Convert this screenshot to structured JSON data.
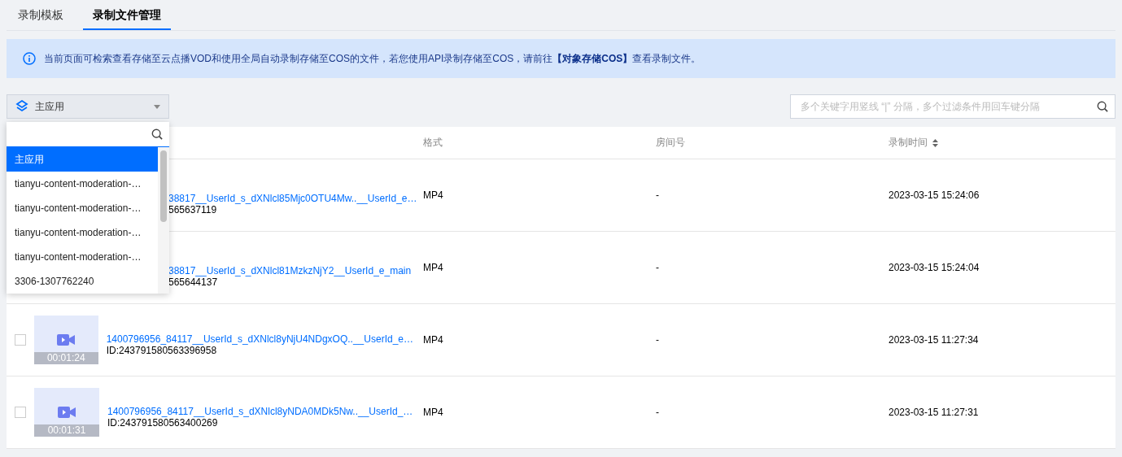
{
  "tabs": [
    {
      "label": "录制模板",
      "selected": false
    },
    {
      "label": "录制文件管理",
      "selected": true
    }
  ],
  "notice": {
    "text": "当前页面可检索查看存储至云点播VOD和使用全局自动录制存储至COS的文件，若您使用API录制存储至COS，请前往",
    "link": "【对象存储COS】",
    "tail": "查看录制文件。"
  },
  "app_select": {
    "value": "主应用"
  },
  "search": {
    "placeholder": "多个关键字用竖线 “|” 分隔，多个过滤条件用回车键分隔"
  },
  "dropdown": {
    "items": [
      {
        "label": "主应用",
        "selected": true
      },
      {
        "label": "tianyu-content-moderation-…",
        "selected": false
      },
      {
        "label": "tianyu-content-moderation-…",
        "selected": false
      },
      {
        "label": "tianyu-content-moderation-…",
        "selected": false
      },
      {
        "label": "tianyu-content-moderation-…",
        "selected": false
      },
      {
        "label": "3306-1307762240",
        "selected": false
      }
    ]
  },
  "table": {
    "columns": [
      "格式",
      "房间号",
      "录制时间"
    ],
    "rows": [
      {
        "kind": "covered",
        "name": "38817__UserId_s_dXNlcl85Mjc0OTU4Mw..__UserId_e…",
        "id": "565637119",
        "format": "MP4",
        "room": "-",
        "time": "2023-03-15 15:24:06"
      },
      {
        "kind": "covered",
        "name": "38817__UserId_s_dXNlcl81MzkzNjY2__UserId_e_main",
        "id": "565644137",
        "format": "MP4",
        "room": "-",
        "time": "2023-03-15 15:24:04"
      },
      {
        "kind": "full",
        "checked": false,
        "duration": "00:01:24",
        "name": "1400796956_84117__UserId_s_dXNlcl8yNjU4NDgxOQ..__UserId_e…",
        "id": "ID:243791580563396958",
        "format": "MP4",
        "room": "-",
        "time": "2023-03-15 11:27:34"
      },
      {
        "kind": "full",
        "checked": false,
        "duration": "00:01:31",
        "name": "1400796956_84117__UserId_s_dXNlcl8yNDA0MDk5Nw..__UserId_…",
        "id": "ID:243791580563400269",
        "format": "MP4",
        "room": "-",
        "time": "2023-03-15 11:27:31"
      }
    ]
  }
}
